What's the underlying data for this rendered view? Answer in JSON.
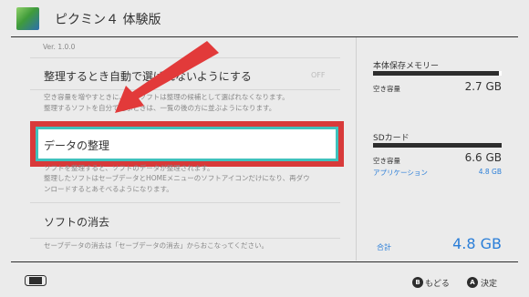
{
  "header": {
    "title": "ピクミン４ 体験版"
  },
  "settings": {
    "version": "Ver. 1.0.0",
    "auto_archive": {
      "title": "整理するとき自動で選ばれないようにする",
      "state": "OFF",
      "desc_line1": "空き容量を増やすときに、このソフトは整理の候補として選ばれなくなります。",
      "desc_line2": "整理するソフトを自分で選ぶときは、一覧の後の方に並ぶようになります。"
    },
    "data_manage": {
      "title": "データの整理",
      "desc_line1": "ソフトを整理すると、ソフトのデータが整理されます。",
      "desc_line2": "整理したソフトはセーブデータとHOMEメニューのソフトアイコンだけになり、再ダウ",
      "desc_line3": "ンロードするとあそべるようになります。"
    },
    "delete_software": {
      "title": "ソフトの消去",
      "desc": "セーブデータの消去は「セーブデータの消去」からおこなってください。"
    }
  },
  "storage": {
    "system": {
      "label": "本体保存メモリー",
      "free_label": "空き容量",
      "free_value": "2.7 GB",
      "used_fraction": 0.98
    },
    "sd": {
      "label": "SDカード",
      "free_label": "空き容量",
      "free_value": "6.6 GB",
      "app_label": "アプリケーション",
      "app_value": "4.8 GB"
    },
    "total": {
      "label": "合計",
      "value": "4.8 GB"
    }
  },
  "footer": {
    "back_button_glyph": "B",
    "back_label": "もどる",
    "ok_button_glyph": "A",
    "ok_label": "決定",
    "console_icon": "switch-console-icon"
  },
  "colors": {
    "accent": "#2a7ed8",
    "highlight_red": "#d83a3a",
    "selection_teal": "#3fc2bd"
  }
}
